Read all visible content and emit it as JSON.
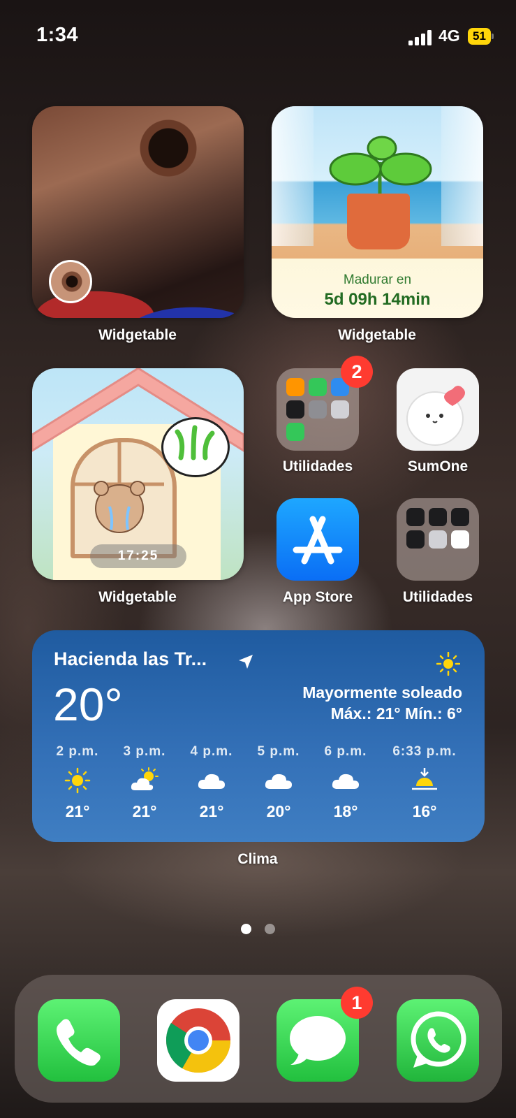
{
  "status_bar": {
    "time": "1:34",
    "network": "4G",
    "battery": "51"
  },
  "widgets": {
    "photo": {
      "label": "Widgetable"
    },
    "plant": {
      "label": "Widgetable",
      "caption": "Madurar en",
      "timer": "5d 09h 14min"
    },
    "house": {
      "label": "Widgetable",
      "time": "17:25"
    }
  },
  "apps": {
    "folder_1": {
      "label": "Utilidades",
      "badge": "2"
    },
    "sumone": {
      "label": "SumOne"
    },
    "app_store": {
      "label": "App Store"
    },
    "folder_2": {
      "label": "Utilidades"
    }
  },
  "weather": {
    "label": "Clima",
    "location": "Hacienda las Tr...",
    "temperature": "20°",
    "condition": "Mayormente soleado",
    "range": "Máx.: 21° Mín.: 6°",
    "hourly": [
      {
        "time": "2 p.m.",
        "icon": "sun-icon",
        "temp": "21°"
      },
      {
        "time": "3 p.m.",
        "icon": "partly-sunny-icon",
        "temp": "21°"
      },
      {
        "time": "4 p.m.",
        "icon": "cloud-icon",
        "temp": "21°"
      },
      {
        "time": "5 p.m.",
        "icon": "cloud-icon",
        "temp": "20°"
      },
      {
        "time": "6 p.m.",
        "icon": "cloud-icon",
        "temp": "18°"
      },
      {
        "time": "6:33 p.m.",
        "icon": "sunset-icon",
        "temp": "16°"
      }
    ]
  },
  "page_indicator": {
    "pages": 2,
    "current": 1
  },
  "dock": {
    "messages_badge": "1",
    "apps": [
      "phone-icon",
      "chrome-icon",
      "messages-icon",
      "whatsapp-icon"
    ]
  },
  "colors": {
    "badge": "#ff3b30",
    "weather_bg": "#2f6db3",
    "battery": "#ffd60a"
  }
}
